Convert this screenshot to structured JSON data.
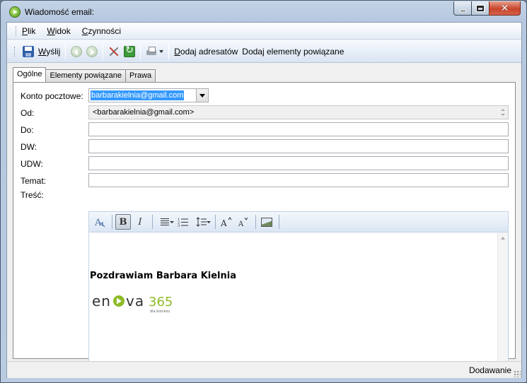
{
  "window": {
    "title": "Wiadomość email:"
  },
  "menu": {
    "items": [
      "Plik",
      "Widok",
      "Czynności"
    ]
  },
  "toolbar": {
    "send_label": "Wyślij",
    "add_recipients_label": "Dodaj adresatów",
    "add_related_label": "Dodaj elementy powiązane"
  },
  "tabs": [
    "Ogólne",
    "Elementy powiązane",
    "Prawa"
  ],
  "form": {
    "account_label": "Konto pocztowe:",
    "account_value": "barbarakielnia@gmail.com",
    "from_label": "Od:",
    "from_value": "<barbarakielnia@gmail.com>",
    "to_label": "Do:",
    "cc_label": "DW:",
    "bcc_label": "UDW:",
    "subject_label": "Temat:",
    "body_label": "Treść:"
  },
  "editor": {
    "bold_glyph": "B",
    "italic_glyph": "I",
    "signature": "Pozdrawiam Barbara Kielnia",
    "logo": {
      "text": "enova",
      "number": "365",
      "tagline": "dla biznesu",
      "accent_color": "#8dbb27"
    }
  },
  "status": {
    "mode": "Dodawanie"
  }
}
